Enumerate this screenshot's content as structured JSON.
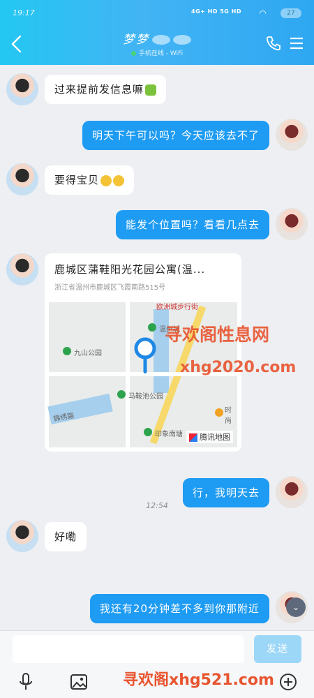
{
  "status": {
    "time": "19:17",
    "network": "4G+ HD  5G HD",
    "battery": "27"
  },
  "header": {
    "title": "梦梦",
    "subtitle": "手机在线 - WiFi"
  },
  "messages": [
    {
      "side": "in",
      "text": "过来提前发信息嘛"
    },
    {
      "side": "out",
      "text": "明天下午可以吗？今天应该去不了"
    },
    {
      "side": "in",
      "text": "要得宝贝"
    },
    {
      "side": "out",
      "text": "能发个位置吗？看看几点去"
    },
    {
      "side": "out",
      "text": "行，我明天去"
    },
    {
      "side": "in",
      "text": "好嘞"
    },
    {
      "side": "out",
      "text": "我还有20分钟差不多到你那附近"
    }
  ],
  "location": {
    "title": "鹿城区蒲鞋阳光花园公寓(温...",
    "address": "浙江省温州市鹿城区飞霞南路515号",
    "map_labels": [
      "温州城",
      "九山公园",
      "马鞍池公园",
      "印象南塘",
      "时尚",
      "欧洲城步行街",
      "锦绣路"
    ],
    "brand": "腾讯地图"
  },
  "timestamp": "12:54",
  "input": {
    "placeholder": "",
    "send_label": "发送"
  },
  "watermarks": {
    "w1": "寻欢阁性息网",
    "w2": "xhg2020.com",
    "w3": "寻欢阁xhg521.com"
  }
}
